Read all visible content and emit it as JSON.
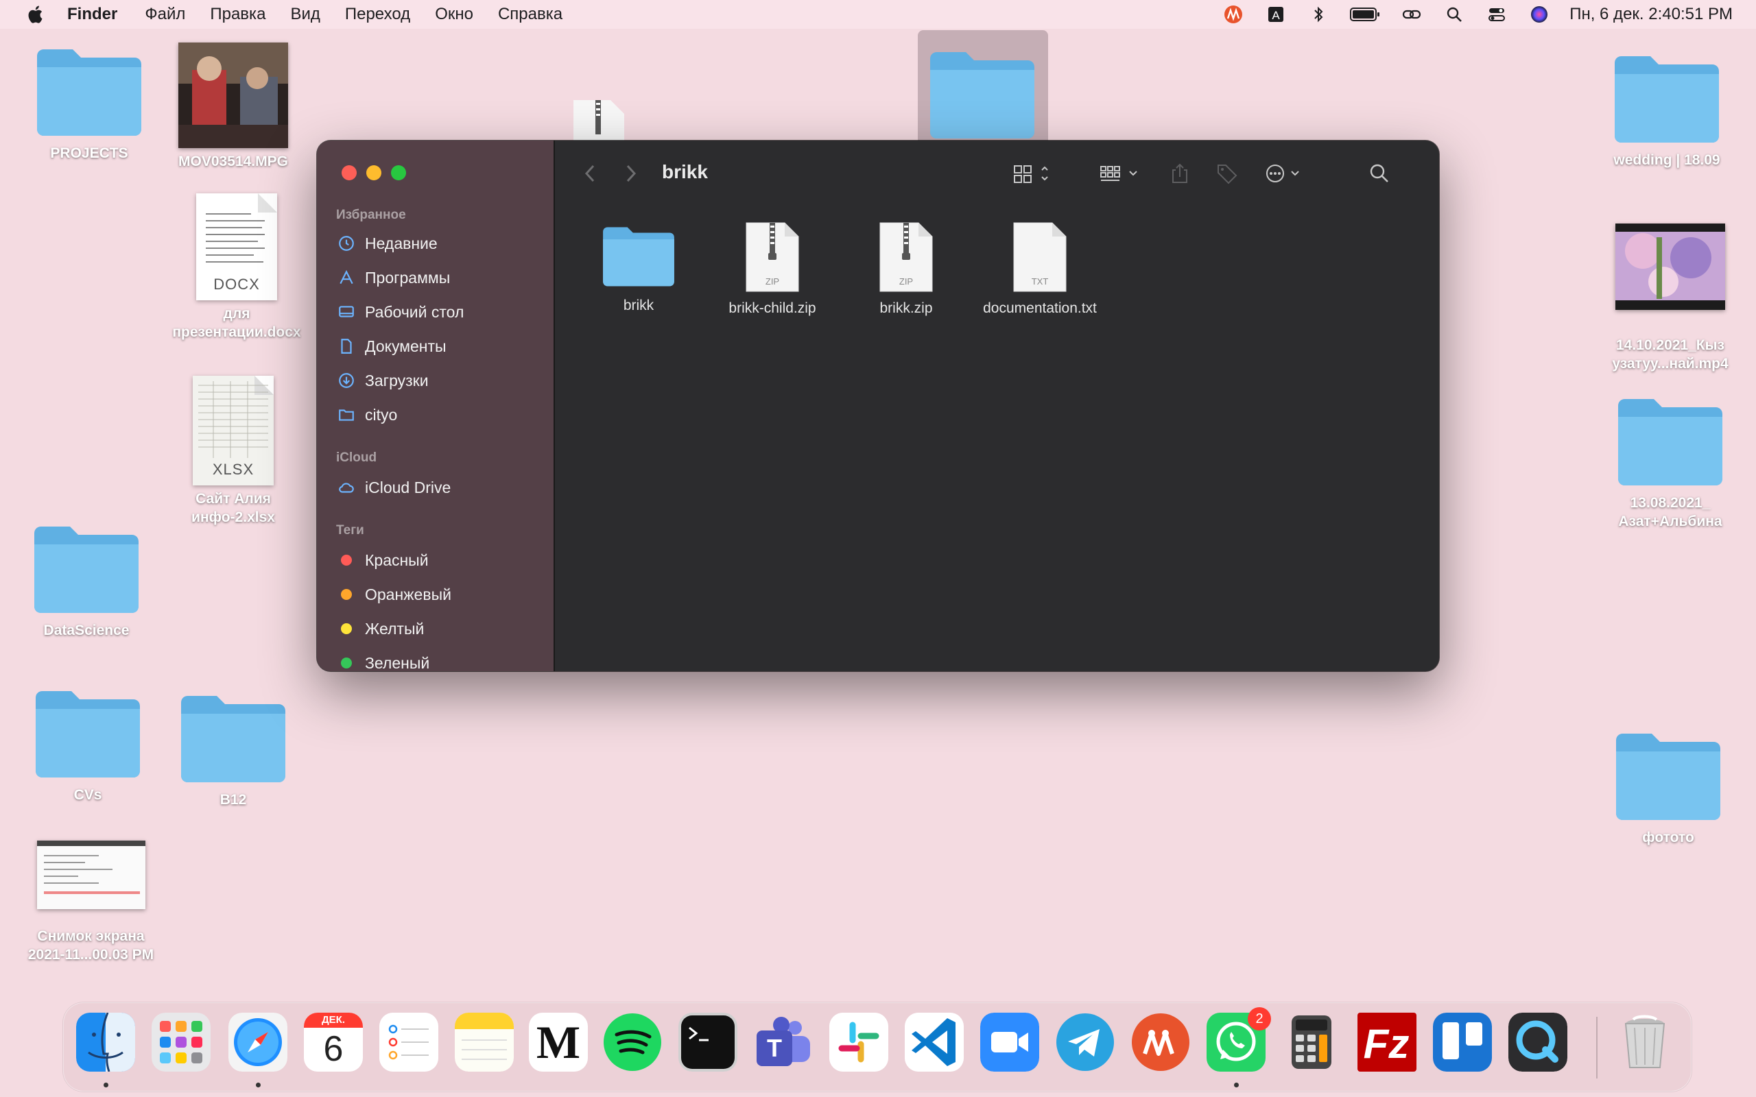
{
  "menubar": {
    "app_name": "Finder",
    "items": [
      "Файл",
      "Правка",
      "Вид",
      "Переход",
      "Окно",
      "Справка"
    ],
    "status_icons": [
      "miro-icon",
      "keyboard-a-icon",
      "bluetooth-icon",
      "battery-icon",
      "link-icon",
      "search-icon",
      "control-center-icon",
      "siri-icon"
    ],
    "keyboard_letter": "A",
    "clock": "Пн, 6 дек.  2:40:51 PM"
  },
  "desktop": {
    "icons": [
      {
        "label": "PROJECTS"
      },
      {
        "label": "MOV03514.MPG"
      },
      {
        "label": "для\nпрезентации.docx",
        "ext": "DOCX"
      },
      {
        "label": "Сайт Алия\nинфо-2.xlsx",
        "ext": "XLSX"
      },
      {
        "label": "DataScience"
      },
      {
        "label": "CVs"
      },
      {
        "label": "B12"
      },
      {
        "label": "Снимок экрана\n2021-11...00.03 PM"
      },
      {
        "label": "wedding | 18.09"
      },
      {
        "label": "14.10.2021_Кыз\nузатуу...най.mp4"
      },
      {
        "label": "13.08.2021_\nАзат+Альбина"
      },
      {
        "label": "фотото"
      }
    ]
  },
  "finder": {
    "title": "brikk",
    "sidebar": {
      "favorites_header": "Избранное",
      "favorites": [
        {
          "label": "Недавние",
          "icon": "clock-icon"
        },
        {
          "label": "Программы",
          "icon": "apps-icon"
        },
        {
          "label": "Рабочий стол",
          "icon": "desktop-icon"
        },
        {
          "label": "Документы",
          "icon": "document-icon"
        },
        {
          "label": "Загрузки",
          "icon": "download-icon"
        },
        {
          "label": "cityo",
          "icon": "folder-icon"
        }
      ],
      "icloud_header": "iCloud",
      "icloud": [
        {
          "label": "iCloud Drive",
          "icon": "cloud-icon"
        }
      ],
      "tags_header": "Теги",
      "tags": [
        {
          "label": "Красный",
          "color": "#ff5b57"
        },
        {
          "label": "Оранжевый",
          "color": "#ffa62b"
        },
        {
          "label": "Желтый",
          "color": "#fee43a"
        },
        {
          "label": "Зеленый",
          "color": "#35c759"
        }
      ]
    },
    "files": [
      {
        "name": "brikk",
        "kind": "folder"
      },
      {
        "name": "brikk-child.zip",
        "kind": "zip",
        "ext": "ZIP"
      },
      {
        "name": "brikk.zip",
        "kind": "zip",
        "ext": "ZIP"
      },
      {
        "name": "documentation.txt",
        "kind": "txt",
        "ext": "TXT"
      }
    ]
  },
  "dock": {
    "apps": [
      "Finder",
      "Launchpad",
      "Safari",
      "Calendar",
      "Reminders",
      "Notes",
      "Medium",
      "Spotify",
      "Terminal",
      "Teams",
      "Slack",
      "VS Code",
      "Zoom",
      "Telegram",
      "Miro",
      "WhatsApp",
      "Calculator",
      "FileZilla",
      "Trello",
      "QuickTime",
      "Trash"
    ],
    "calendar_month": "ДЕК.",
    "calendar_day": "6",
    "whatsapp_badge": "2",
    "medium_letter": "M"
  }
}
